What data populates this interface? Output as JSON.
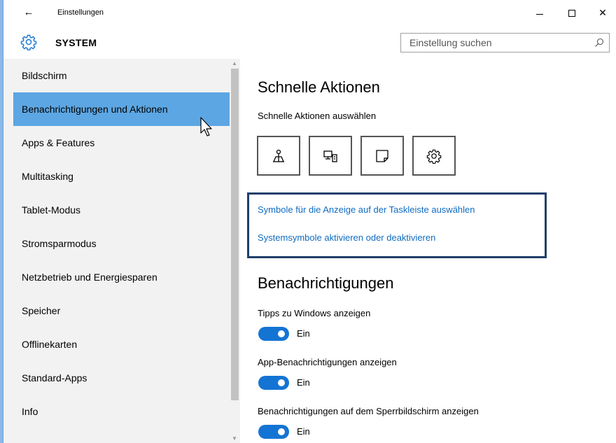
{
  "window": {
    "title": "Einstellungen",
    "back_icon": "back-arrow-icon",
    "minimize_icon": "minimize-icon",
    "maximize_icon": "maximize-icon",
    "close_icon": "close-icon",
    "close_glyph": "✕"
  },
  "header": {
    "title": "SYSTEM",
    "icon": "gear-icon",
    "search_placeholder": "Einstellung suchen"
  },
  "sidebar": {
    "items": [
      {
        "label": "Bildschirm"
      },
      {
        "label": "Benachrichtigungen und Aktionen",
        "active": true
      },
      {
        "label": "Apps & Features"
      },
      {
        "label": "Multitasking"
      },
      {
        "label": "Tablet-Modus"
      },
      {
        "label": "Stromsparmodus"
      },
      {
        "label": "Netzbetrieb und Energiesparen"
      },
      {
        "label": "Speicher"
      },
      {
        "label": "Offlinekarten"
      },
      {
        "label": "Standard-Apps"
      },
      {
        "label": "Info"
      }
    ]
  },
  "main": {
    "quick_actions_title": "Schnelle Aktionen",
    "quick_actions_label": "Schnelle Aktionen auswählen",
    "quick_action_tiles": [
      "connect-icon",
      "project-icon",
      "note-icon",
      "settings-gear-icon"
    ],
    "links": {
      "taskbar_icons": "Symbole für die Anzeige auf der Taskleiste auswählen",
      "system_icons": "Systemsymbole aktivieren oder deaktivieren"
    },
    "notifications_title": "Benachrichtigungen",
    "settings": [
      {
        "label": "Tipps zu Windows anzeigen",
        "state": "Ein",
        "on": true
      },
      {
        "label": "App-Benachrichtigungen anzeigen",
        "state": "Ein",
        "on": true
      },
      {
        "label": "Benachrichtigungen auf dem Sperrbildschirm anzeigen",
        "state": "Ein",
        "on": true
      }
    ]
  },
  "colors": {
    "accent": "#1474d4",
    "sidebar_active": "#5ca6e3",
    "link": "#0f6cc1",
    "highlight_border": "#1f3f6b"
  }
}
